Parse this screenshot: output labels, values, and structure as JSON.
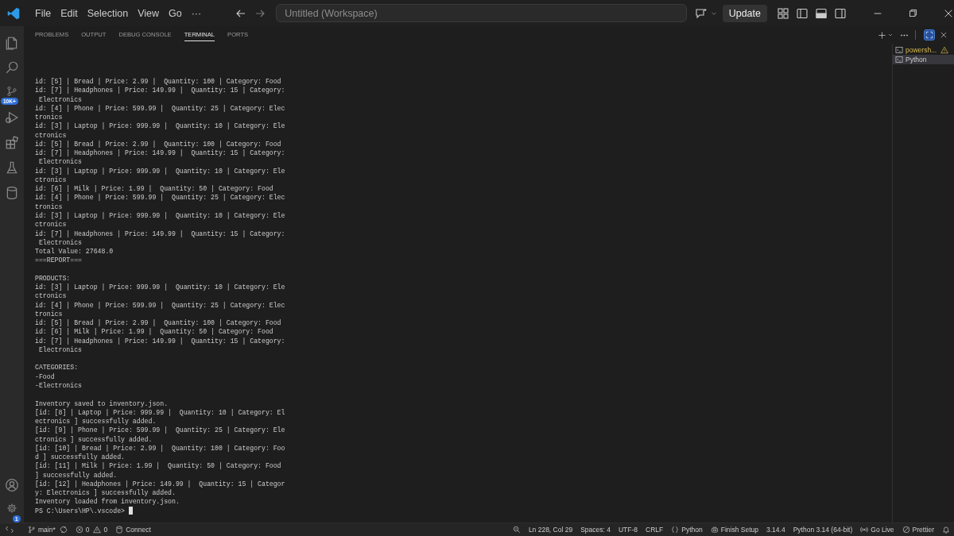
{
  "title_bar": {
    "menu": [
      "File",
      "Edit",
      "Selection",
      "View",
      "Go",
      "···"
    ],
    "command_center": {
      "placeholder": "Untitled (Workspace)"
    },
    "update_button": "Update"
  },
  "activity_bar": {
    "source_control_badge": "10K+",
    "settings_badge": "1"
  },
  "panel": {
    "tabs": [
      {
        "label": "PROBLEMS",
        "selected": false
      },
      {
        "label": "OUTPUT",
        "selected": false
      },
      {
        "label": "DEBUG CONSOLE",
        "selected": false
      },
      {
        "label": "TERMINAL",
        "selected": true
      },
      {
        "label": "PORTS",
        "selected": false
      }
    ]
  },
  "terminal": {
    "blocks": [
      [
        "id: [5] | Bread | Price: 2.99 |  Quantity: 100 | Category: Food",
        "id: [7] | Headphones | Price: 149.99 |  Quantity: 15 | Category:",
        " Electronics",
        "id: [4] | Phone | Price: 599.99 |  Quantity: 25 | Category: Elec",
        "tronics",
        "id: [3] | Laptop | Price: 999.99 |  Quantity: 10 | Category: Ele",
        "ctronics",
        "id: [5] | Bread | Price: 2.99 |  Quantity: 100 | Category: Food",
        "id: [7] | Headphones | Price: 149.99 |  Quantity: 15 | Category:",
        " Electronics",
        "id: [3] | Laptop | Price: 999.99 |  Quantity: 10 | Category: Ele",
        "ctronics",
        "id: [6] | Milk | Price: 1.99 |  Quantity: 50 | Category: Food",
        "id: [4] | Phone | Price: 599.99 |  Quantity: 25 | Category: Elec",
        "tronics",
        "id: [3] | Laptop | Price: 999.99 |  Quantity: 10 | Category: Ele",
        "ctronics",
        "id: [7] | Headphones | Price: 149.99 |  Quantity: 15 | Category:",
        " Electronics",
        "Total Value: 27648.0",
        "===REPORT==="
      ],
      [
        "PRODUCTS:",
        "id: [3] | Laptop | Price: 999.99 |  Quantity: 10 | Category: Ele",
        "ctronics",
        "id: [4] | Phone | Price: 599.99 |  Quantity: 25 | Category: Elec",
        "tronics",
        "id: [5] | Bread | Price: 2.99 |  Quantity: 100 | Category: Food",
        "id: [6] | Milk | Price: 1.99 |  Quantity: 50 | Category: Food",
        "id: [7] | Headphones | Price: 149.99 |  Quantity: 15 | Category:",
        " Electronics"
      ],
      [
        "CATEGORIES:",
        "-Food",
        "-Electronics"
      ],
      [
        "Inventory saved to inventory.json.",
        "[id: [8] | Laptop | Price: 999.99 |  Quantity: 10 | Category: El",
        "ectronics ] successfully added.",
        "[id: [9] | Phone | Price: 599.99 |  Quantity: 25 | Category: Ele",
        "ctronics ] successfully added.",
        "[id: [10] | Bread | Price: 2.99 |  Quantity: 100 | Category: Foo",
        "d ] successfully added.",
        "[id: [11] | Milk | Price: 1.99 |  Quantity: 50 | Category: Food",
        "] successfully added.",
        "[id: [12] | Headphones | Price: 149.99 |  Quantity: 15 | Categor",
        "y: Electronics ] successfully added.",
        "Inventory loaded from inventory.json."
      ]
    ],
    "prompt": "PS C:\\Users\\HP\\.vscode>"
  },
  "terminal_list": [
    {
      "label": "powersh...",
      "selected": false,
      "warning": true
    },
    {
      "label": "Python",
      "selected": true,
      "warning": false
    }
  ],
  "status_bar": {
    "branch": "main*",
    "errors": "0",
    "warnings": "0",
    "connect": "Connect",
    "right": [
      {
        "kind": "zoom"
      },
      {
        "kind": "text",
        "label": "Ln 228, Col 29"
      },
      {
        "kind": "text",
        "label": "Spaces: 4"
      },
      {
        "kind": "text",
        "label": "UTF-8"
      },
      {
        "kind": "text",
        "label": "CRLF"
      },
      {
        "kind": "braces",
        "label": "Python"
      },
      {
        "kind": "copilot",
        "label": "Finish Setup"
      },
      {
        "kind": "text",
        "label": "3.14.4"
      },
      {
        "kind": "text",
        "label": "Python 3.14 (64-bit)"
      },
      {
        "kind": "broadcast",
        "label": "Go Live"
      },
      {
        "kind": "prettier",
        "label": "Prettier"
      },
      {
        "kind": "bell"
      }
    ]
  }
}
